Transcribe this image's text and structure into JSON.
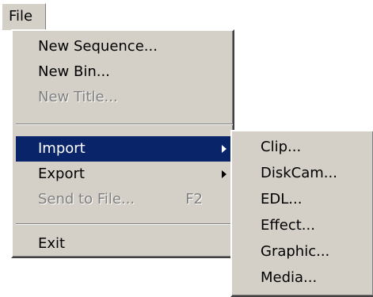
{
  "menubar": {
    "file_label": "File"
  },
  "file_menu": {
    "items": [
      {
        "label": "New Sequence...",
        "enabled": true
      },
      {
        "label": "New Bin...",
        "enabled": true
      },
      {
        "label": "New Title...",
        "enabled": false
      },
      {
        "label": "Import",
        "enabled": true,
        "submenu": true,
        "selected": true
      },
      {
        "label": "Export",
        "enabled": true,
        "submenu": true
      },
      {
        "label": "Send to File...",
        "enabled": false,
        "shortcut": "F2"
      },
      {
        "label": "Exit",
        "enabled": true
      }
    ]
  },
  "import_submenu": {
    "items": [
      {
        "label": "Clip..."
      },
      {
        "label": "DiskCam..."
      },
      {
        "label": "EDL..."
      },
      {
        "label": "Effect..."
      },
      {
        "label": "Graphic..."
      },
      {
        "label": "Media..."
      }
    ]
  },
  "colors": {
    "menu_bg": "#d4d0c8",
    "selection_bg": "#0a246a",
    "selection_text": "#ffffff",
    "disabled_text": "#808080"
  }
}
